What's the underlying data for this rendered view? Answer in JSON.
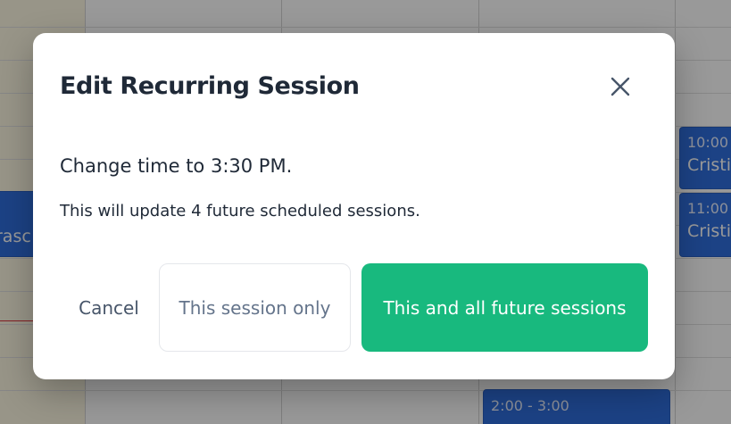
{
  "calendar": {
    "events": [
      {
        "time": "",
        "name": "rasc"
      },
      {
        "time": "10:00 -",
        "name": "Cristi"
      },
      {
        "time": "11:00 -",
        "name": "Cristi"
      },
      {
        "time": "2:00 - 3:00",
        "name": ""
      }
    ]
  },
  "modal": {
    "title": "Edit Recurring Session",
    "close_icon": "close-icon",
    "message": "Change time to 3:30 PM.",
    "detail": "This will update 4 future scheduled sessions.",
    "buttons": {
      "cancel": "Cancel",
      "this_only": "This session only",
      "all_future": "This and all future sessions"
    }
  },
  "colors": {
    "primary_button": "#18b97e",
    "event_blue": "#2f6fde",
    "title_text": "#1f2937"
  }
}
